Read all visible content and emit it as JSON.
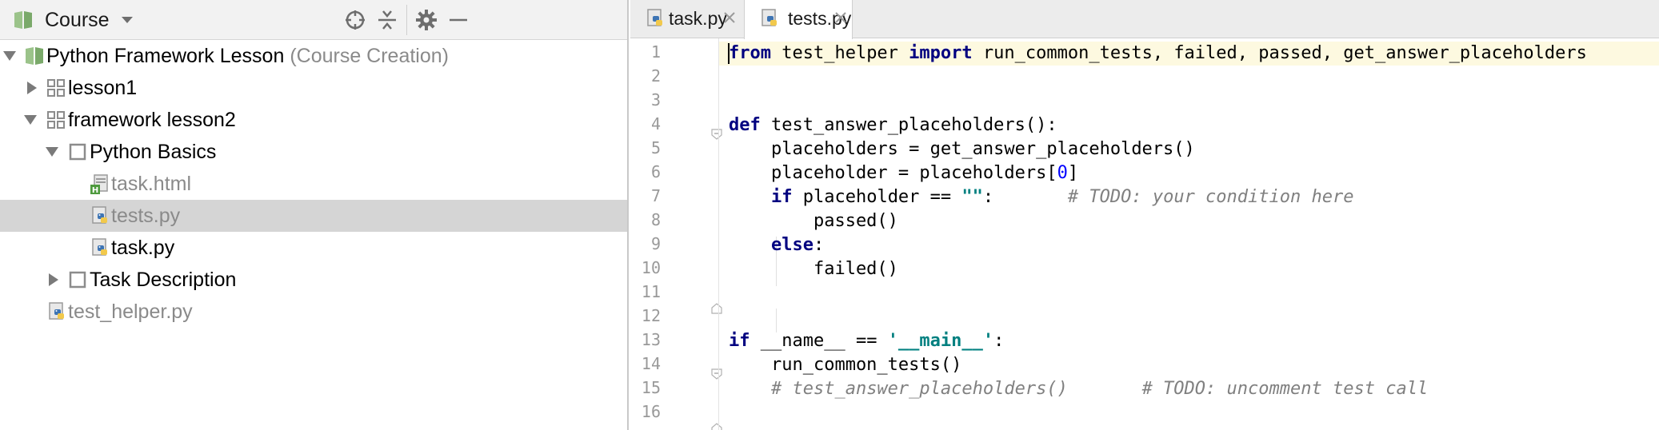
{
  "project_panel": {
    "title": "Course",
    "tree": [
      {
        "label": "Python Framework Lesson",
        "hint": "(Course Creation)",
        "icon": "course-icon",
        "expanded": true
      },
      {
        "label": "lesson1",
        "icon": "lesson-grid-icon",
        "expanded": false
      },
      {
        "label": "framework lesson2",
        "icon": "lesson-grid-icon",
        "expanded": true
      },
      {
        "label": "Python Basics",
        "icon": "task-square-icon",
        "expanded": true
      },
      {
        "label": "task.html",
        "icon": "html-file-icon"
      },
      {
        "label": "tests.py",
        "icon": "python-file-icon",
        "selected": true
      },
      {
        "label": "task.py",
        "icon": "python-file-icon"
      },
      {
        "label": "Task Description",
        "icon": "task-square-icon",
        "expanded": false
      },
      {
        "label": "test_helper.py",
        "icon": "python-file-icon"
      }
    ]
  },
  "editor": {
    "tabs": [
      {
        "label": "task.py",
        "active": false
      },
      {
        "label": "tests.py",
        "active": true
      }
    ],
    "line_numbers": [
      "1",
      "2",
      "3",
      "4",
      "5",
      "6",
      "7",
      "8",
      "9",
      "10",
      "11",
      "12",
      "13",
      "14",
      "15",
      "16"
    ],
    "current_line": 1,
    "code": {
      "l1": {
        "kw1": "from",
        "t1": " test_helper ",
        "kw2": "import",
        "t2": " run_common_tests, failed, passed, get_answer_placeholders"
      },
      "l4": {
        "kw": "def",
        "t": " test_answer_placeholders():"
      },
      "l5": {
        "t": "    placeholders = get_answer_placeholders()"
      },
      "l6": {
        "t1": "    placeholder = placeholders[",
        "num": "0",
        "t2": "]"
      },
      "l7": {
        "pre": "    ",
        "kw": "if",
        "t": " placeholder == ",
        "str": "\"\"",
        "t2": ":       ",
        "cmt": "# TODO: your condition here"
      },
      "l8": {
        "t": "        passed()"
      },
      "l9": {
        "pre": "    ",
        "kw": "else",
        "t": ":"
      },
      "l10": {
        "t": "        failed()"
      },
      "l13": {
        "kw": "if",
        "t": " __name__ == ",
        "str": "'__main__'",
        "t2": ":"
      },
      "l14": {
        "t": "    run_common_tests()"
      },
      "l15": {
        "pre": "    ",
        "cmt": "# test_answer_placeholders()       # TODO: uncomment test call"
      }
    }
  },
  "colors": {
    "keyword": "#000080",
    "number": "#0000ff",
    "string": "#008080",
    "comment": "#808080",
    "selection": "#d5d5d5",
    "current_line": "#fdf9e0"
  }
}
